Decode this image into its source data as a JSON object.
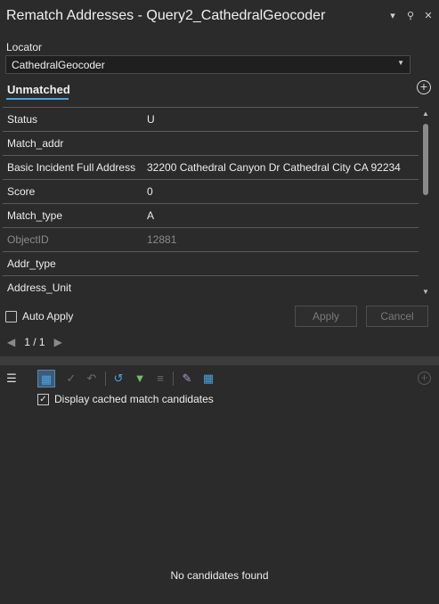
{
  "window": {
    "title": "Rematch Addresses - Query2_CathedralGeocoder",
    "options_icon": "chevron-down-icon",
    "pin_icon": "pin-icon",
    "close_icon": "close-icon"
  },
  "locator": {
    "label": "Locator",
    "value": "CathedralGeocoder"
  },
  "tabs": {
    "active": "Unmatched"
  },
  "attributes": [
    {
      "key": "Status",
      "value": "U",
      "editable": true
    },
    {
      "key": "Match_addr",
      "value": "",
      "editable": true
    },
    {
      "key": "Basic Incident Full Address",
      "value": "32200 Cathedral Canyon Dr Cathedral City CA 92234",
      "editable": true
    },
    {
      "key": "Score",
      "value": "0",
      "editable": true
    },
    {
      "key": "Match_type",
      "value": "A",
      "editable": true
    },
    {
      "key": "ObjectID",
      "value": "12881",
      "editable": false
    },
    {
      "key": "Addr_type",
      "value": "",
      "editable": true
    },
    {
      "key": "Address_Unit",
      "value": "",
      "editable": true
    }
  ],
  "controls": {
    "auto_apply_label": "Auto Apply",
    "auto_apply_checked": false,
    "apply_label": "Apply",
    "cancel_label": "Cancel"
  },
  "pager": {
    "text": "1 / 1"
  },
  "candidates": {
    "display_cached_label": "Display cached match candidates",
    "display_cached_checked": true,
    "empty_text": "No candidates found"
  },
  "colors": {
    "background": "#2b2b2b",
    "accent": "#4aa3df"
  }
}
